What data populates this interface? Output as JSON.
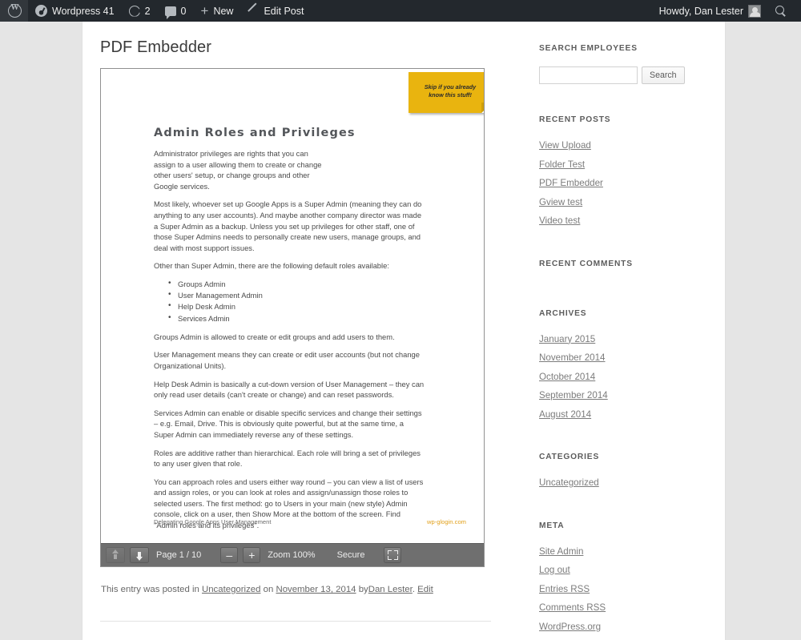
{
  "adminbar": {
    "wp_logo": "wordpress-logo",
    "site_name": "Wordpress 41",
    "updates_count": "2",
    "comments_count": "0",
    "new_label": "New",
    "edit_post_label": "Edit Post",
    "howdy": "Howdy, Dan Lester",
    "search_icon": "search-icon"
  },
  "entry": {
    "title": "PDF Embedder",
    "meta_prefix": "This entry was posted in",
    "category": "Uncategorized",
    "meta_on": "on",
    "date": "November 13, 2014",
    "meta_by": "by",
    "author": "Dan Lester",
    "meta_period": ".",
    "edit_label": "Edit"
  },
  "pdf": {
    "heading": "Admin Roles and Privileges",
    "sticky_note": "Skip if you already know this stuff!",
    "paragraphs": [
      "Administrator privileges are rights that you can assign to a user allowing them to create or change other users' setup, or change groups and other Google services.",
      "Most likely, whoever set up Google Apps is a Super Admin (meaning they can do anything to any user accounts). And maybe another company director was made a Super Admin as a backup. Unless you set up privileges for other staff, one of those Super Admins needs to personally create new users, manage groups, and deal with most support issues.",
      "Other than Super Admin, there are the following default roles available:"
    ],
    "roles": [
      "Groups Admin",
      "User Management Admin",
      "Help Desk Admin",
      "Services Admin"
    ],
    "paragraphs_after": [
      "Groups Admin is allowed to create or edit groups and add users to them.",
      "User Management means they can create or edit user accounts (but not change Organizational Units).",
      "Help Desk Admin is basically a cut-down version of User Management – they can only read user details (can't create or change) and can reset passwords.",
      "Services Admin can enable or disable specific services and change their settings – e.g. Email, Drive. This is obviously quite powerful, but at the same time, a Super Admin can immediately reverse any of these settings.",
      "Roles are additive rather than hierarchical. Each role will bring a set of privileges to any user given that role.",
      "You can approach roles and users either way round – you can view a list of users and assign roles, or you can look at roles and assign/unassign those roles to selected users. The first method: go to Users in your main (new style) Admin console, click on a user, then Show More at the bottom of the screen. Find \"Admin roles and its privileges\"."
    ],
    "footer_left": "Delegating Google Apps User Management",
    "footer_right": "wp-glogin.com",
    "footer_right_color": "#e2a11c"
  },
  "pdf_toolbar": {
    "prev_page_icon": "arrow-up-icon",
    "next_page_icon": "arrow-down-icon",
    "page_label": "Page 1 / 10",
    "zoom_out_label": "–",
    "zoom_in_label": "+",
    "zoom_label": "Zoom 100%",
    "secure_label": "Secure",
    "fullscreen_icon": "fullscreen-icon",
    "background": "#6f6f6f"
  },
  "sidebar": {
    "search": {
      "title": "SEARCH EMPLOYEES",
      "value": "",
      "placeholder": "",
      "button_label": "Search"
    },
    "recent_posts": {
      "title": "RECENT POSTS",
      "items": [
        "View Upload",
        "Folder Test",
        "PDF Embedder",
        "Gview test",
        "Video test"
      ]
    },
    "recent_comments": {
      "title": "RECENT COMMENTS",
      "items": []
    },
    "archives": {
      "title": "ARCHIVES",
      "items": [
        "January 2015",
        "November 2014",
        "October 2014",
        "September 2014",
        "August 2014"
      ]
    },
    "categories": {
      "title": "CATEGORIES",
      "items": [
        "Uncategorized"
      ]
    },
    "meta": {
      "title": "META",
      "items": [
        "Site Admin",
        "Log out",
        "Entries RSS",
        "Comments RSS",
        "WordPress.org"
      ]
    }
  },
  "colors": {
    "adminbar_bg": "#23282d",
    "page_bg": "#e5e5e5",
    "content_bg": "#ffffff",
    "sticky_note": "#e9b40f",
    "link": "#7c7c7c"
  }
}
